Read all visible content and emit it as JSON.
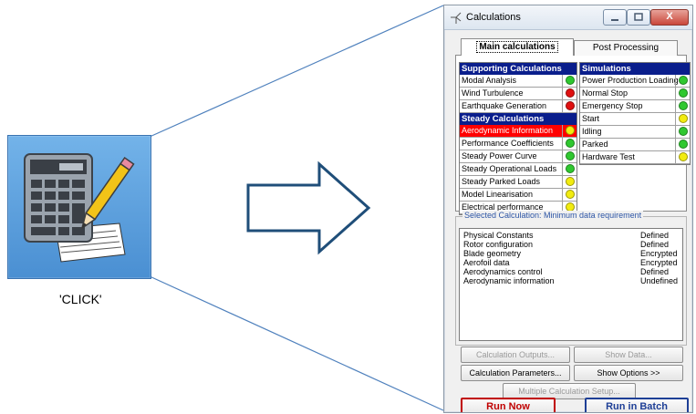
{
  "left_icon": {
    "caption": "'CLICK'",
    "icon": "calculator-with-pencil-icon"
  },
  "window": {
    "title": "Calculations",
    "close_label": "X"
  },
  "tabs": [
    {
      "label": "Main calculations",
      "active": true
    },
    {
      "label": "Post Processing",
      "active": false
    }
  ],
  "supporting": {
    "header": "Supporting Calculations",
    "items": [
      {
        "label": "Modal Analysis",
        "status": "green"
      },
      {
        "label": "Wind Turbulence",
        "status": "red"
      },
      {
        "label": "Earthquake Generation",
        "status": "red"
      }
    ]
  },
  "steady": {
    "header": "Steady Calculations",
    "items": [
      {
        "label": "Aerodynamic Information",
        "status": "yellow",
        "selected": true
      },
      {
        "label": "Performance Coefficients",
        "status": "green"
      },
      {
        "label": "Steady Power Curve",
        "status": "green"
      },
      {
        "label": "Steady Operational Loads",
        "status": "green"
      },
      {
        "label": "Steady Parked Loads",
        "status": "yellow"
      },
      {
        "label": "Model Linearisation",
        "status": "yellow"
      },
      {
        "label": "Electrical performance",
        "status": "yellow"
      }
    ]
  },
  "simulations": {
    "header": "Simulations",
    "items": [
      {
        "label": "Power Production Loading",
        "status": "green"
      },
      {
        "label": "Normal Stop",
        "status": "green"
      },
      {
        "label": "Emergency Stop",
        "status": "green"
      },
      {
        "label": "Start",
        "status": "yellow"
      },
      {
        "label": "Idling",
        "status": "green"
      },
      {
        "label": "Parked",
        "status": "green"
      },
      {
        "label": "Hardware Test",
        "status": "yellow"
      }
    ]
  },
  "requirement": {
    "title": "Selected Calculation: Minimum data requirement",
    "rows": [
      {
        "name": "Physical Constants",
        "status": "Defined"
      },
      {
        "name": "Rotor configuration",
        "status": "Defined"
      },
      {
        "name": "Blade geometry",
        "status": "Encrypted"
      },
      {
        "name": "Aerofoil data",
        "status": "Encrypted"
      },
      {
        "name": "Aerodynamics control",
        "status": "Defined"
      },
      {
        "name": "Aerodynamic information",
        "status": "Undefined"
      }
    ]
  },
  "buttons": {
    "calc_outputs": "Calculation Outputs...",
    "show_data": "Show Data...",
    "calc_params": "Calculation Parameters...",
    "show_options": "Show Options >>",
    "multi_setup": "Multiple Calculation Setup...",
    "run_now": "Run Now",
    "run_batch": "Run in Batch"
  },
  "colors": {
    "green": "#2fc82f",
    "red": "#e01010",
    "yellow": "#f2ec10",
    "header_blue": "#0a1e8c",
    "highlight_red": "#ff0000"
  }
}
